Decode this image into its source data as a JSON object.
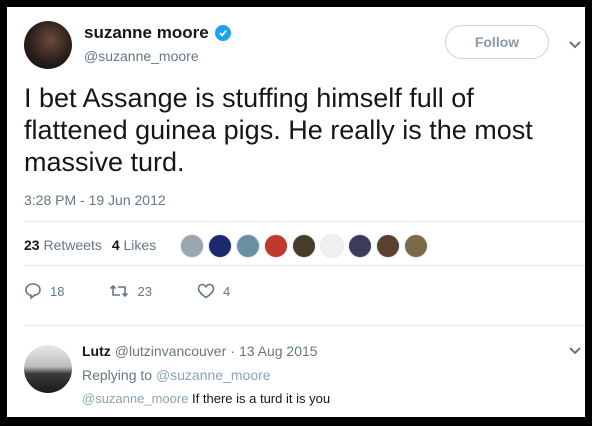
{
  "author": {
    "name": "suzanne moore",
    "handle": "@suzanne_moore",
    "verified": true
  },
  "follow_label": "Follow",
  "tweet": {
    "line1": "I bet Assange is stuffing himself full of",
    "line2": "flattened guinea pigs. He really is the most",
    "line3": "massive turd.",
    "timestamp": "3:28 PM - 19 Jun 2012"
  },
  "stats": {
    "retweets_count": "23",
    "retweets_label": "Retweets",
    "likes_count": "4",
    "likes_label": "Likes"
  },
  "likers_colors": [
    "#9aa5b0",
    "#1e2a6b",
    "#6b8fa3",
    "#c0392b",
    "#4a3b2a",
    "#f0f0f0",
    "#3c3c5a",
    "#5a4030",
    "#7a6a4a"
  ],
  "actions": {
    "reply_count": "18",
    "retweet_count": "23",
    "like_count": "4"
  },
  "reply": {
    "name": "Lutz",
    "handle": "@lutzinvancouver",
    "separator": "·",
    "date": "13 Aug 2015",
    "replying_prefix": "Replying to",
    "replying_to": "@suzanne_moore",
    "mention": "@suzanne_moore",
    "text": " If there is a turd it is you"
  },
  "colors": {
    "accent": "#1da1f2",
    "secondary_text": "#657786"
  }
}
